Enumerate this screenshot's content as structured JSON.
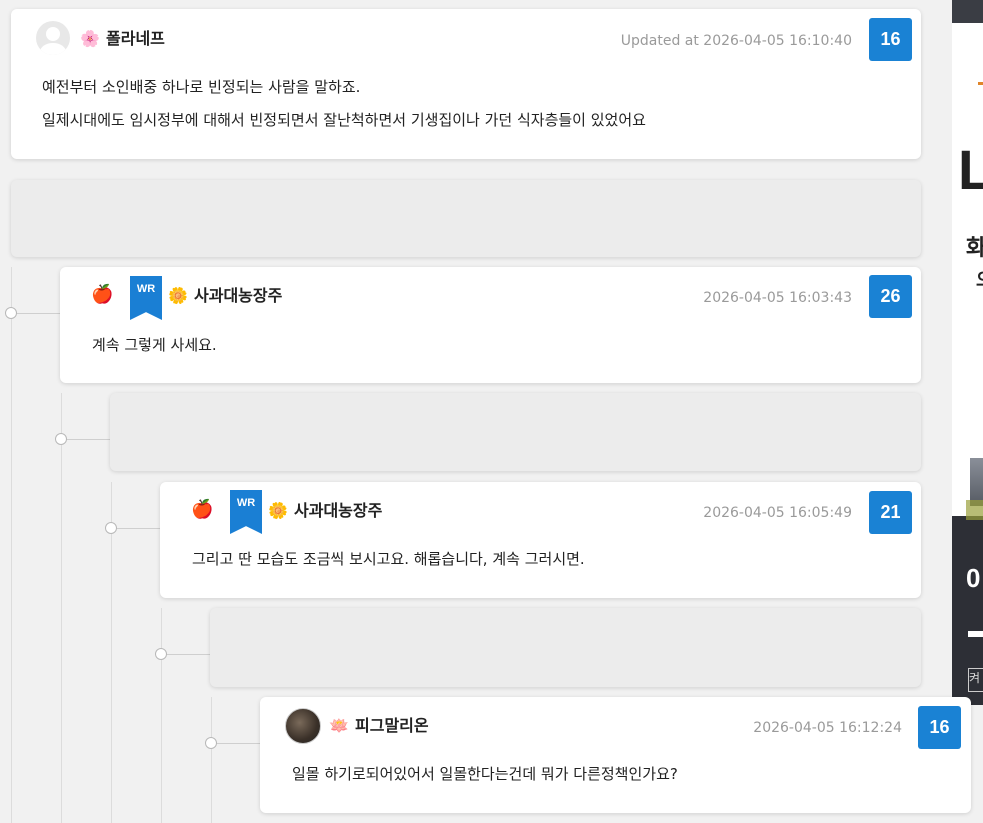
{
  "colors": {
    "accent": "#1a82d4",
    "card": "#ffffff",
    "background": "#f1f1f1"
  },
  "comments": [
    {
      "nickname": "폴라네프",
      "nick_emoji": "🌸",
      "date": "Updated at 2026-04-05 16:10:40",
      "count": "16",
      "lines": [
        "예전부터 소인배중 하나로 빈정되는 사람을 말하죠.",
        "일제시대에도 임시정부에 대해서 빈정되면서  잘난척하면서 기생집이나 가던 식자층들이 있었어요"
      ]
    },
    {
      "author_badge": "WR",
      "nickname": "사과대농장주",
      "nick_emoji": "🌼",
      "date": "2026-04-05 16:03:43",
      "count": "26",
      "lines": [
        "계속 그렇게 사세요."
      ]
    },
    {
      "author_badge": "WR",
      "nickname": "사과대농장주",
      "nick_emoji": "🌼",
      "date": "2026-04-05 16:05:49",
      "count": "21",
      "lines": [
        "그리고 딴 모습도 조금씩 보시고요. 해롭습니다, 계속 그러시면."
      ]
    },
    {
      "nickname": "피그말리온",
      "nick_emoji": "🪷",
      "date": "2026-04-05 16:12:24",
      "count": "16",
      "lines": [
        "일몰 하기로되어있어서 일몰한다는건데 뭐가 다른정책인가요?"
      ]
    }
  ],
  "ad": {
    "headline": "L",
    "line1": "화",
    "line2": "오",
    "number": "0",
    "button": "켜"
  }
}
